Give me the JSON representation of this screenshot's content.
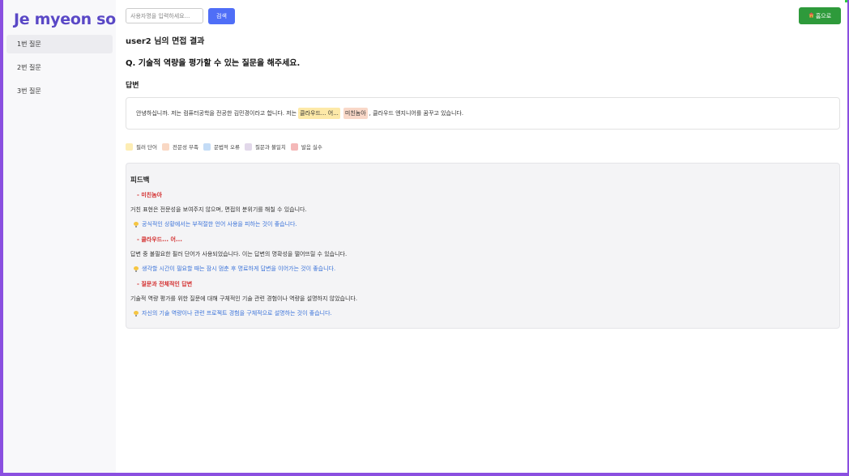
{
  "app": {
    "logo": "Je myeon so"
  },
  "sidebar": {
    "items": [
      {
        "label": "1번 질문",
        "active": true
      },
      {
        "label": "2번 질문",
        "active": false
      },
      {
        "label": "3번 질문",
        "active": false
      }
    ]
  },
  "search": {
    "placeholder": "사용자명을 입력하세요...",
    "button_label": "검색"
  },
  "home_button": {
    "icon": "house-icon",
    "label": "홈으로"
  },
  "result": {
    "title": "user2 님의 면접 결과",
    "question": "Q. 기술적 역량을 평가할 수 있는 질문을 해주세요.",
    "answer_heading": "답변",
    "answer": {
      "part1": "안녕하십니까. 저는 컴퓨터공학을 전공한 김민경이라고 합니다. 저는",
      "filler": "클라우드... 어...",
      "unprofessional": "미친놈아",
      "part2": ", 클라우드 엔지니어를 꿈꾸고 있습니다."
    }
  },
  "legend": [
    {
      "label": "필러 단어",
      "color": "#fdedb4"
    },
    {
      "label": "전문성 부족",
      "color": "#f9d8c4"
    },
    {
      "label": "문법적 오류",
      "color": "#c4dcf6"
    },
    {
      "label": "질문과 불일치",
      "color": "#e2d8ea"
    },
    {
      "label": "발음 실수",
      "color": "#f4b8b8"
    }
  ],
  "feedback": {
    "title": "피드백",
    "items": [
      {
        "issue": "- 미친놈아",
        "description": "거친 표현은 전문성을 보여주지 않으며, 면접의 분위기를 해칠 수 있습니다.",
        "tip": "공식적인 상황에서는 부적절한 언어 사용을 피하는 것이 좋습니다."
      },
      {
        "issue": "- 클라우드... 어...",
        "description": "답변 중 불필요한 필러 단어가 사용되었습니다. 이는 답변의 명확성을 떨어뜨릴 수 있습니다.",
        "tip": "생각할 시간이 필요할 때는 잠시 멈춘 후 명료하게 답변을 이어가는 것이 좋습니다."
      },
      {
        "issue": "- 질문과 전체적인 답변",
        "description": "기술적 역량 평가를 위한 질문에 대해 구체적인 기술 관련 경험이나 역량을 설명하지 않았습니다.",
        "tip": "자신의 기술 역량이나 관련 프로젝트 경험을 구체적으로 설명하는 것이 좋습니다."
      }
    ]
  },
  "colors": {
    "brand": "#5a48c6",
    "frame": "#8a4fe0",
    "search_button": "#4f6ef7",
    "home_button": "#2e9a3b",
    "issue_text": "#d32f2f",
    "tip_text": "#3b73d9"
  }
}
